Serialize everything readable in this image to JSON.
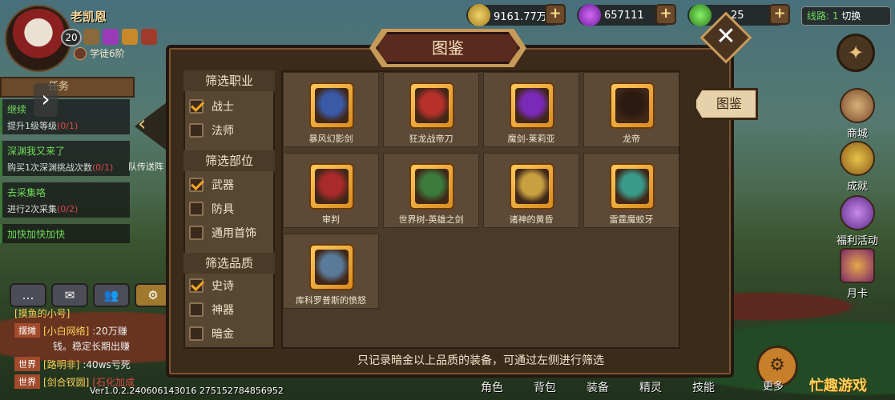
{
  "player": {
    "name": "老凯恩",
    "level": "20",
    "rank": "学徒6阶"
  },
  "resources": {
    "gold": "9161.77万",
    "gems": "657111",
    "stamina": "25"
  },
  "line": {
    "label": "线路",
    "value": "1",
    "switch": "切换"
  },
  "tasks": {
    "tab_label": "任务",
    "items": [
      {
        "title": "继续",
        "desc": "提升1级等级",
        "progress": "(0/1)"
      },
      {
        "title": "深渊我又来了",
        "desc": "购买1次深渊挑战次数",
        "progress": "(0/1)"
      },
      {
        "title": "去采集咯",
        "desc": "进行2次采集",
        "progress": "(0/2)"
      },
      {
        "title": "加快加快加快",
        "desc": "",
        "progress": ""
      }
    ],
    "portal_hint": "队传送阵"
  },
  "chat": {
    "lines": [
      {
        "channel": "摆摊",
        "name": "[小白网络]",
        "text": ":20万赚"
      },
      {
        "channel": "世界",
        "name": "[路明非]",
        "text": ":40ws亏死"
      },
      {
        "channel": "世界",
        "name": "[剑合钗圆]",
        "text": "[石化加成"
      }
    ],
    "continued": "钱。稳定长期出赚",
    "line0_partial": "[摸鱼的小号]"
  },
  "version": "Ver1.0.2.240606143016 275152784856952",
  "modal": {
    "title": "图鉴",
    "side_tab": "图鉴",
    "footer": "只记录暗金以上品质的装备，可通过左侧进行筛选",
    "filters": [
      {
        "heading": "筛选职业",
        "options": [
          {
            "label": "战士",
            "checked": true
          },
          {
            "label": "法师",
            "checked": false
          }
        ]
      },
      {
        "heading": "筛选部位",
        "options": [
          {
            "label": "武器",
            "checked": true
          },
          {
            "label": "防具",
            "checked": false
          },
          {
            "label": "通用首饰",
            "checked": false
          }
        ]
      },
      {
        "heading": "筛选品质",
        "options": [
          {
            "label": "史诗",
            "checked": true
          },
          {
            "label": "神器",
            "checked": false
          },
          {
            "label": "暗金",
            "checked": false
          }
        ]
      }
    ],
    "items": [
      {
        "name": "暴风幻影剑",
        "icon": "gauntlet-blue-icon"
      },
      {
        "name": "狂龙战帝刀",
        "icon": "dragon-red-icon"
      },
      {
        "name": "魔剑-莱莉亚",
        "icon": "eye-claw-purple-icon"
      },
      {
        "name": "龙帝",
        "icon": "dragon-dark-icon"
      },
      {
        "name": "审判",
        "icon": "claw-red-icon"
      },
      {
        "name": "世界树-英雄之剑",
        "icon": "sword-green-icon"
      },
      {
        "name": "诸神的黄昏",
        "icon": "claw-gold-icon"
      },
      {
        "name": "雷霆魔蛟牙",
        "icon": "claw-teal-icon"
      },
      {
        "name": "库科罗普斯的愤怒",
        "icon": "gauntlet-steel-icon"
      }
    ]
  },
  "right_menu": [
    {
      "label": "商城"
    },
    {
      "label": "成就"
    },
    {
      "label": "福利活动"
    },
    {
      "label": "月卡"
    }
  ],
  "bottom_tabs": [
    "角色",
    "背包",
    "装备",
    "精灵",
    "技能"
  ],
  "more_label": "更多",
  "right_bottom_tab": "任务",
  "watermark": "忙趣游戏"
}
